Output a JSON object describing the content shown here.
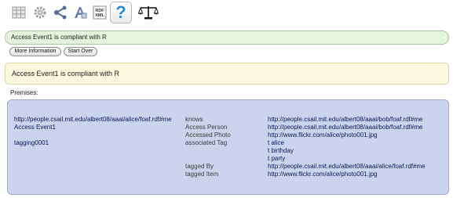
{
  "toolbar": {
    "icons": [
      "table-icon",
      "gear-icon",
      "share-icon",
      "format-icon",
      "rdf-xml-icon",
      "help-icon",
      "scales-icon"
    ],
    "rdf_label": "RDF\nXML",
    "help_label": "?"
  },
  "status": {
    "text": "Access Event1 is compliant with R"
  },
  "buttons": {
    "more_info": "More Information",
    "start_over": "Start Over"
  },
  "message": {
    "text": "Access Event1 is compliant with R"
  },
  "premises": {
    "label": "Premises:",
    "rows": [
      {
        "subject": "http://people.csail.mit.edu/albert08/aaai/alice/foaf.rdf#me",
        "predicate": "knows",
        "object": "http://people.csail.mit.edu/albert08/aaai/bob/foaf.rdf#me"
      },
      {
        "subject": "Access Event1",
        "predicate": "Access Person",
        "object": "http://people.csail.mit.edu/albert08/aaai/bob/foaf.rdf#me"
      },
      {
        "subject": "",
        "predicate": "Accessed Photo",
        "object": "http://www.flickr.com/alice/photo001.jpg"
      },
      {
        "subject": "tagging0001",
        "predicate": "associated Tag",
        "object": "t alice"
      },
      {
        "subject": "",
        "predicate": "",
        "object": "t birthday"
      },
      {
        "subject": "",
        "predicate": "",
        "object": "t party"
      },
      {
        "subject": "",
        "predicate": "tagged By",
        "object": "http://people.csail.mit.edu/albert08/aaai/alice/foaf.rdf#me"
      },
      {
        "subject": "",
        "predicate": "tagged Item",
        "object": "http://www.flickr.com/alice/photo001.jpg"
      }
    ]
  },
  "colors": {
    "status_bg": "#e4f3db",
    "message_bg": "#fbf9dd",
    "panel_bg": "#cbd3ee",
    "help_accent": "#2a8fd8"
  }
}
